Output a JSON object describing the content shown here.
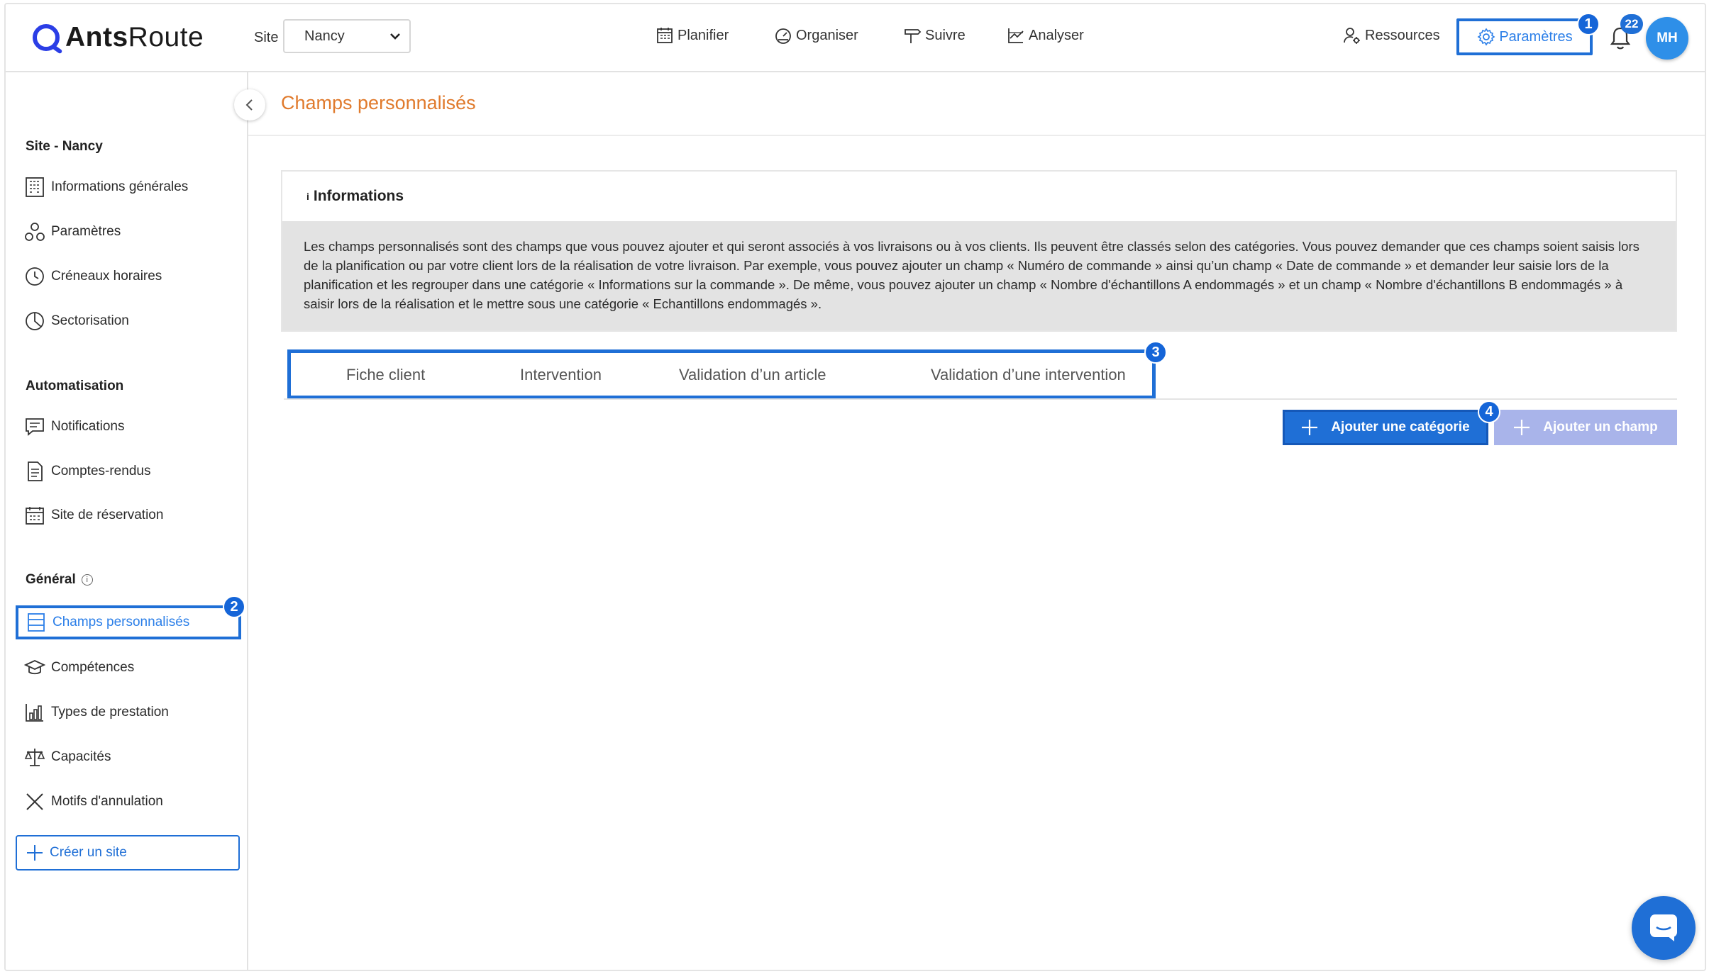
{
  "app": {
    "logo_bold": "Ants",
    "logo_light": "Route"
  },
  "topbar": {
    "site_label": "Site",
    "site_value": "Nancy",
    "nav": [
      {
        "label": "Planifier",
        "icon": "calendar-icon"
      },
      {
        "label": "Organiser",
        "icon": "dashboard-gauge-icon"
      },
      {
        "label": "Suivre",
        "icon": "signpost-icon"
      },
      {
        "label": "Analyser",
        "icon": "chart-icon"
      }
    ],
    "resources_label": "Ressources",
    "params_label": "Paramètres",
    "notif_count": "22",
    "avatar_initials": "MH",
    "accent": "#1f6fd6"
  },
  "steps": {
    "s1": "1",
    "s2": "2",
    "s3": "3",
    "s4": "4"
  },
  "sidebar": {
    "section_site": "Site - Nancy",
    "site_items": [
      {
        "label": "Informations générales",
        "icon": "building-icon"
      },
      {
        "label": "Paramètres",
        "icon": "settings-nodes-icon"
      },
      {
        "label": "Créneaux horaires",
        "icon": "clock-icon"
      },
      {
        "label": "Sectorisation",
        "icon": "pie-chart-icon"
      }
    ],
    "section_auto": "Automatisation",
    "auto_items": [
      {
        "label": "Notifications",
        "icon": "message-icon"
      },
      {
        "label": "Comptes-rendus",
        "icon": "document-icon"
      },
      {
        "label": "Site de réservation",
        "icon": "calendar-grid-icon"
      }
    ],
    "section_general": "Général",
    "general_items": [
      {
        "label": "Champs personnalisés",
        "icon": "form-fields-icon"
      },
      {
        "label": "Compétences",
        "icon": "graduation-cap-icon"
      },
      {
        "label": "Types de prestation",
        "icon": "bar-chart-icon"
      },
      {
        "label": "Capacités",
        "icon": "scale-icon"
      },
      {
        "label": "Motifs d'annulation",
        "icon": "close-icon"
      }
    ],
    "create_site": "Créer un site"
  },
  "main": {
    "title": "Champs personnalisés",
    "title_color": "#e07a2c",
    "info_title": "Informations",
    "info_text": "Les champs personnalisés sont des champs que vous pouvez ajouter et qui seront associés à vos livraisons ou à vos clients. Ils peuvent être classés selon des catégories. Vous pouvez demander que ces champs soient saisis lors de la planification ou par votre client lors de la réalisation de votre livraison. Par exemple, vous pouvez ajouter un champ « Numéro de commande » ainsi qu’un champ « Date de commande » et demander leur saisie lors de la planification et les regrouper dans une catégorie « Informations sur la commande ». De même, vous pouvez ajouter un champ « Nombre d'échantillons A endommagés » et un champ « Nombre d'échantillons B endommagés » à saisir lors de la réalisation et le mettre sous une catégorie « Echantillons endommagés ».",
    "tabs": [
      {
        "label": "Fiche client"
      },
      {
        "label": "Intervention"
      },
      {
        "label": "Validation d’un article"
      },
      {
        "label": "Validation d’une intervention"
      }
    ],
    "add_category": "Ajouter une catégorie",
    "add_field": "Ajouter un champ"
  }
}
